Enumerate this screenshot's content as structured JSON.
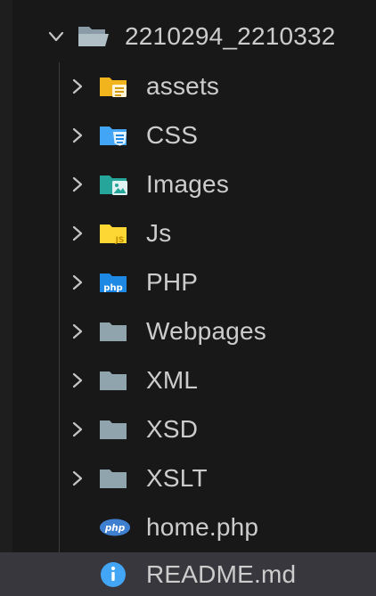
{
  "explorer": {
    "root": {
      "name": "2210294_2210332",
      "expanded": true,
      "icon": "folder-open-icon"
    },
    "folders": [
      {
        "name": "assets",
        "icon": "folder-assets-icon",
        "color": "#f2b41c"
      },
      {
        "name": "CSS",
        "icon": "folder-css-icon",
        "color": "#42a5f5"
      },
      {
        "name": "Images",
        "icon": "folder-images-icon",
        "color": "#26a69a"
      },
      {
        "name": "Js",
        "icon": "folder-js-icon",
        "color": "#fdd835"
      },
      {
        "name": "PHP",
        "icon": "folder-php-icon",
        "color": "#1e88e5"
      },
      {
        "name": "Webpages",
        "icon": "folder-icon",
        "color": "#90a4ae"
      },
      {
        "name": "XML",
        "icon": "folder-icon",
        "color": "#90a4ae"
      },
      {
        "name": "XSD",
        "icon": "folder-icon",
        "color": "#90a4ae"
      },
      {
        "name": "XSLT",
        "icon": "folder-icon",
        "color": "#90a4ae"
      }
    ],
    "files": [
      {
        "name": "home.php",
        "icon": "php-file-icon",
        "icon_text": "php"
      },
      {
        "name": "README.md",
        "icon": "info-icon",
        "selected": true
      }
    ],
    "icon_text": {
      "js": "JS",
      "php": "php"
    }
  }
}
